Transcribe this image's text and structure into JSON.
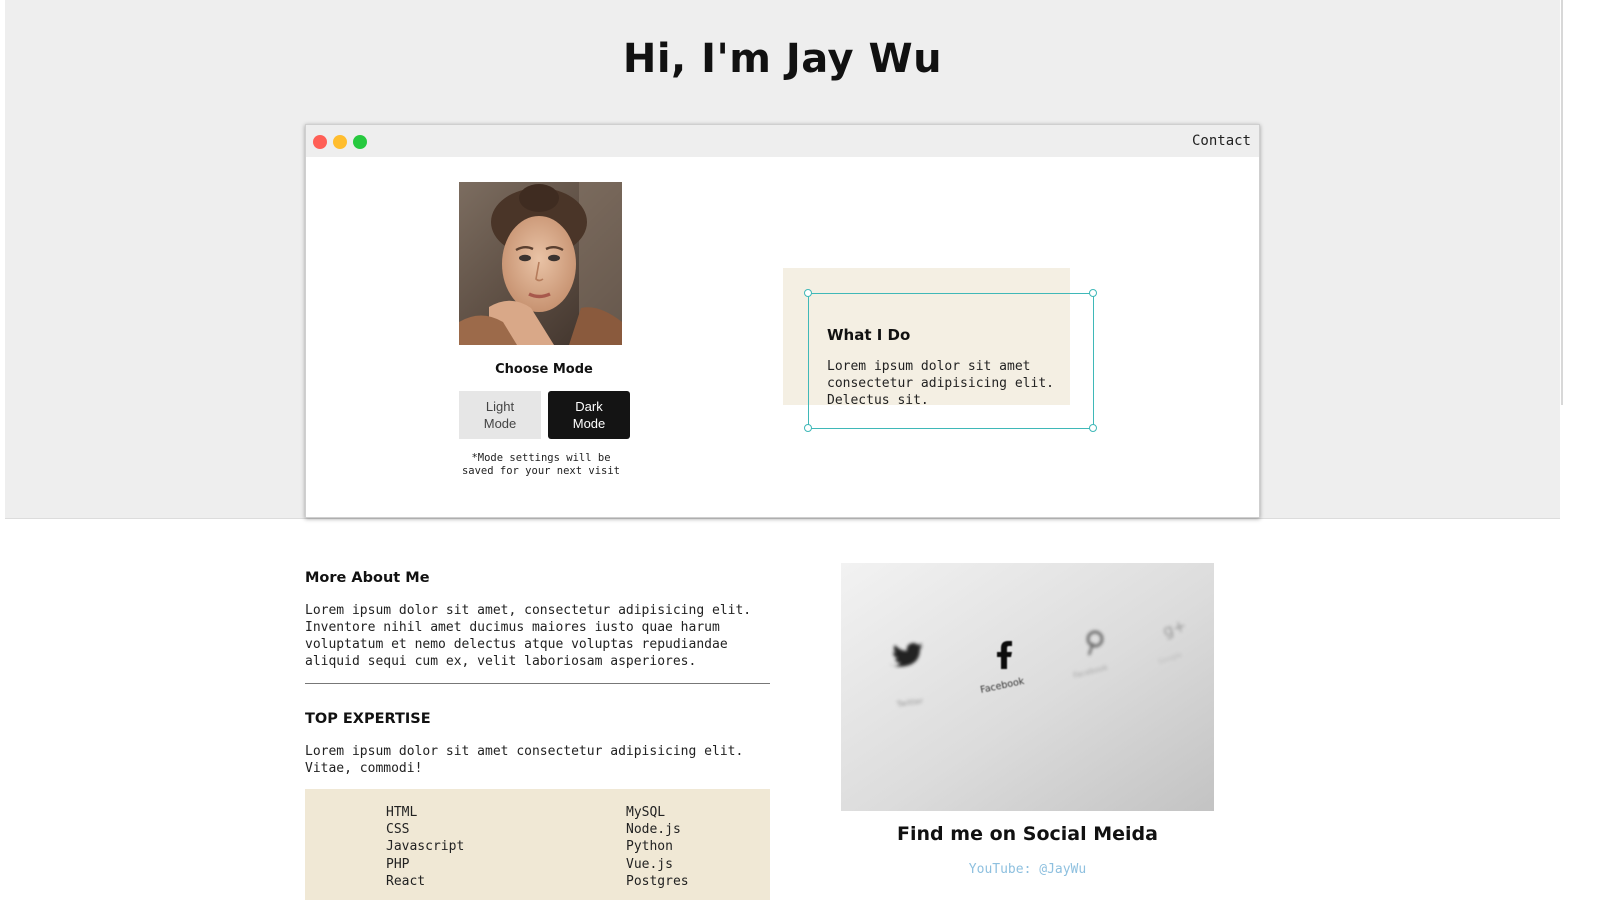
{
  "hero": {
    "title": "Hi, I'm Jay Wu"
  },
  "window": {
    "contact_label": "Contact",
    "choose_mode_label": "Choose Mode",
    "light_mode_label": "Light\nMode",
    "dark_mode_label": "Dark\nMode",
    "mode_note": "*Mode settings will be\nsaved for your next visit",
    "what_i_do": {
      "title": "What I Do",
      "text": "Lorem ipsum dolor sit amet consectetur adipisicing elit. Delectus sit."
    }
  },
  "about": {
    "heading": "More About Me",
    "text": "Lorem ipsum dolor sit amet, consectetur adipisicing elit. Inventore nihil amet ducimus maiores iusto quae harum voluptatum et nemo delectus atque voluptas repudiandae aliquid sequi cum ex, velit laboriosam asperiores."
  },
  "expertise": {
    "heading": "TOP EXPERTISE",
    "text": "Lorem ipsum dolor sit amet consectetur adipisicing elit. Vitae, commodi!",
    "left_column": [
      "HTML",
      "CSS",
      "Javascript",
      "PHP",
      "React"
    ],
    "right_column": [
      "MySQL",
      "Node.js",
      "Python",
      "Vue.js",
      "Postgres"
    ]
  },
  "social": {
    "title": "Find me on Social Meida",
    "youtube_link": "YouTube: @JayWu",
    "photo_labels": {
      "twitter": "Twitter",
      "facebook": "Facebook",
      "pinterest": "Facebook",
      "google": "Google"
    }
  },
  "colors": {
    "hero_bg": "#eeeeee",
    "widget_bg": "#f4efe3",
    "selection_frame": "#3fb8b8",
    "expertise_bg": "#f0e8d5",
    "link": "#8ec0df",
    "dark_button": "#141414"
  }
}
